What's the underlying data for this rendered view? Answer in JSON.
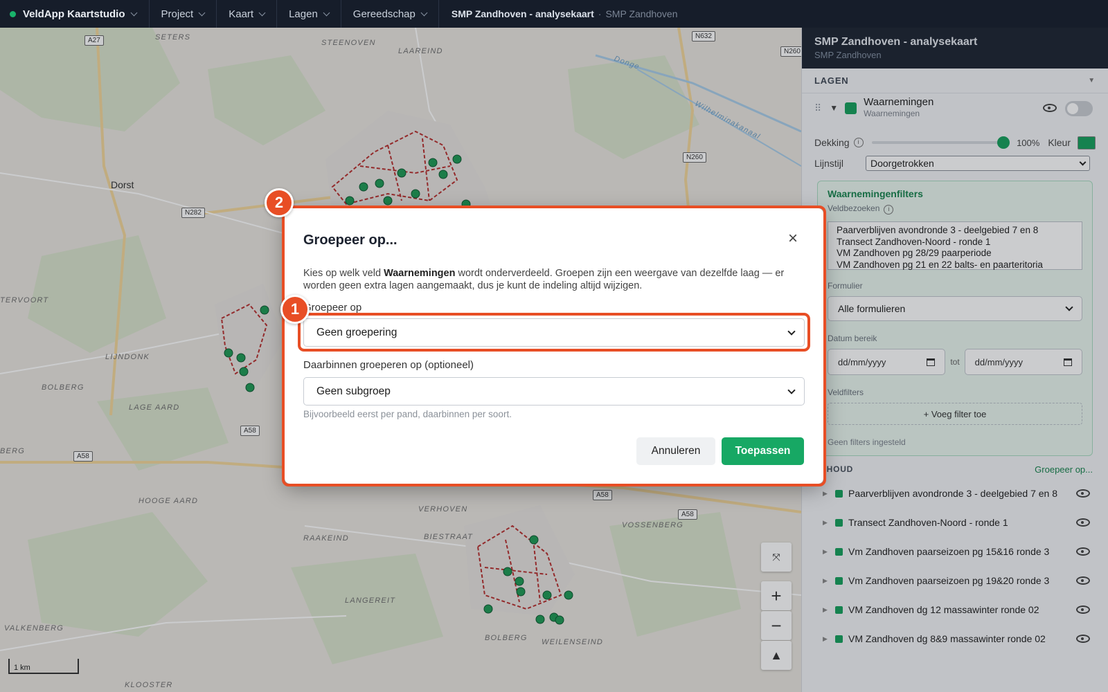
{
  "topbar": {
    "app_name": "VeldApp Kaartstudio",
    "menus": [
      "Project",
      "Kaart",
      "Lagen",
      "Gereedschap"
    ],
    "breadcrumb_title": "SMP Zandhoven - analysekaart",
    "breadcrumb_sub": "SMP Zandhoven"
  },
  "map": {
    "places": [
      "SETERS",
      "STEENOVEN",
      "LAAREIND",
      "TERVOORT",
      "LIJNDONK",
      "BOLBERG",
      "LAGE AARD",
      "HOOGE AARD",
      "VERHOVEN",
      "BIESTRAAT",
      "RAAKEIND",
      "VOSSENBERG",
      "LANGEREIT",
      "BOLBERG",
      "WEILENSEIND",
      "VALKENBERG",
      "KLOOSTER",
      "BERG"
    ],
    "towns": [
      "Dorst"
    ],
    "roads": [
      "A27",
      "N632",
      "N260",
      "N260",
      "N282",
      "A58",
      "A58",
      "A58",
      "A58"
    ],
    "water": [
      "Donge",
      "Wilhelminakanaal"
    ],
    "scale_label": "1 km",
    "controls": {
      "zoom_in": "+",
      "zoom_out": "−",
      "north": "▲"
    }
  },
  "panel": {
    "title": "SMP Zandhoven - analysekaart",
    "subtitle": "SMP Zandhoven",
    "layers_header": "LAGEN",
    "layer": {
      "name": "Waarnemingen",
      "sub": "Waarnemingen",
      "color": "#17a05d"
    },
    "opacity_label": "Dekking",
    "opacity_value": "100%",
    "opacity_fraction": 1.0,
    "color_label": "Kleur",
    "linestyle_label": "Lijnstijl",
    "linestyle_value": "Doorgetrokken",
    "filters": {
      "title": "Waarnemingenfilters",
      "visits_label": "Veldbezoeken",
      "visits": [
        "Paarverblijven avondronde 3 - deelgebied 7 en 8",
        "Transect Zandhoven-Noord - ronde 1",
        "VM Zandhoven pg 28/29 paarperiode",
        "VM Zandhoven pg 21 en 22 balts- en paarteritoria"
      ],
      "form_label": "Formulier",
      "form_value": "Alle formulieren",
      "date_label": "Datum bereik",
      "date_from": "dd/mm/yyyy",
      "date_to_word": "tot",
      "date_to": "dd/mm/yyyy",
      "fieldfilters_label": "Veldfilters",
      "add_filter": "+ Voeg filter toe",
      "no_filters": "Geen filters ingesteld"
    },
    "contents": {
      "header": "INHOUD",
      "group_link": "Groepeer op...",
      "items": [
        "Paarverblijven avondronde 3 - deelgebied 7 en 8",
        "Transect Zandhoven-Noord - ronde 1",
        "Vm Zandhoven paarseizoen pg 15&16 ronde 3",
        "Vm Zandhoven paarseizoen pg 19&20 ronde 3",
        "VM Zandhoven dg 12 massawinter ronde 02",
        "VM Zandhoven dg 8&9 massawinter ronde 02"
      ]
    }
  },
  "modal": {
    "title": "Groepeer op...",
    "close": "×",
    "desc_pre": "Kies op welk veld ",
    "desc_bold": "Waarnemingen",
    "desc_post": " wordt onderverdeeld. Groepen zijn een weergave van dezelfde laag — er worden geen extra lagen aangemaakt, dus je kunt de indeling altijd wijzigen.",
    "group_label": "Groepeer op",
    "group_value": "Geen groepering",
    "sub_label": "Daarbinnen groeperen op (optioneel)",
    "sub_value": "Geen subgroep",
    "hint": "Bijvoorbeeld eerst per pand, daarbinnen per soort.",
    "cancel": "Annuleren",
    "apply": "Toepassen"
  },
  "annotations": {
    "badge1": "1",
    "badge2": "2",
    "color": "#e84e25"
  }
}
